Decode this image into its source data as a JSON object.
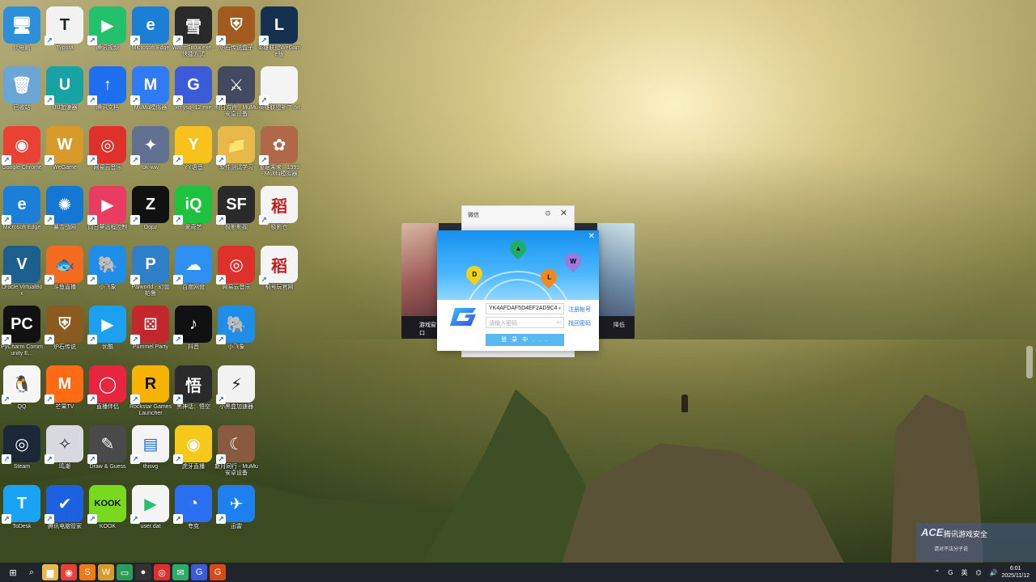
{
  "desktop": {
    "icons": [
      {
        "label": "此电脑",
        "glyph": "🖥",
        "bg": "#2d8fd8"
      },
      {
        "label": "Typora",
        "glyph": "T",
        "bg": "#f2f2f2",
        "fg": "#222"
      },
      {
        "label": "腾讯视频",
        "glyph": "▶",
        "bg": "#23c16b"
      },
      {
        "label": "Microsoft Edge",
        "glyph": "e",
        "bg": "#1b7fd8"
      },
      {
        "label": "WarmSnow.exe - 快捷方式",
        "glyph": "雪",
        "bg": "#2a2a2a"
      },
      {
        "label": "炉石传说盒子",
        "glyph": "⛨",
        "bg": "#a35a1e"
      },
      {
        "label": "英雄联盟WeGame版",
        "glyph": "L",
        "bg": "#14324f"
      },
      {
        "label": "回收站",
        "glyph": "🗑",
        "bg": "#6aa6d6"
      },
      {
        "label": "UU加速器",
        "glyph": "U",
        "bg": "#17a3a3"
      },
      {
        "label": "腾讯文档",
        "glyph": "↑",
        "bg": "#1e6ff0"
      },
      {
        "label": "MuMu模拟器",
        "glyph": "M",
        "bg": "#2f7bf5"
      },
      {
        "label": "xmysq_12.exe",
        "glyph": "G",
        "bg": "#3b5bd8"
      },
      {
        "label": "明日方舟 - MuMu安卓设备",
        "glyph": "⚔",
        "bg": "#434a60"
      },
      {
        "label": "英雄联盟补丁.txt",
        "glyph": "",
        "bg": "#f4f4f4"
      },
      {
        "label": "Google Chrome",
        "glyph": "◉",
        "bg": "#e94235"
      },
      {
        "label": "WeGame",
        "glyph": "W",
        "bg": "#d79a2a"
      },
      {
        "label": "网易云音乐",
        "glyph": "◎",
        "bg": "#e0302b"
      },
      {
        "label": "ok-ww",
        "glyph": "✦",
        "bg": "#607090"
      },
      {
        "label": "YY语音",
        "glyph": "Y",
        "bg": "#f6c21b"
      },
      {
        "label": "软件测试学习",
        "glyph": "📁",
        "bg": "#e8b94a"
      },
      {
        "label": "重返未来：1999 - MuMu模拟器",
        "glyph": "✿",
        "bg": "#b06848"
      },
      {
        "label": "Microsoft Edge",
        "glyph": "e",
        "bg": "#1b7fd8"
      },
      {
        "label": "暴雪战网",
        "glyph": "✺",
        "bg": "#1477d6"
      },
      {
        "label": "向日葵远程控制",
        "glyph": "▶",
        "bg": "#ea3b63"
      },
      {
        "label": "Oopz",
        "glyph": "Z",
        "bg": "#111111"
      },
      {
        "label": "爱奇艺",
        "glyph": "iQ",
        "bg": "#1fc23e"
      },
      {
        "label": "极影影视",
        "glyph": "SF",
        "bg": "#2a2a2a"
      },
      {
        "label": "极影仓",
        "glyph": "稻",
        "bg": "#f4f4f4",
        "fg": "#c02020"
      },
      {
        "label": "Oracle VirtualBox",
        "glyph": "V",
        "bg": "#1c5f8f"
      },
      {
        "label": "斗鱼直播",
        "glyph": "🐟",
        "bg": "#f36b1f"
      },
      {
        "label": "小飞象",
        "glyph": "🐘",
        "bg": "#1f8ee8"
      },
      {
        "label": "Palworld - 幻兽帕鲁",
        "glyph": "P",
        "bg": "#2f7ec8"
      },
      {
        "label": "百度网盘",
        "glyph": "☁",
        "bg": "#2f8ff0"
      },
      {
        "label": "网易云音乐",
        "glyph": "◎",
        "bg": "#e0302b"
      },
      {
        "label": "稻号玩官网",
        "glyph": "稻",
        "bg": "#f4f4f4",
        "fg": "#c02020"
      },
      {
        "label": "PyCharm Community E...",
        "glyph": "PC",
        "bg": "#111111"
      },
      {
        "label": "炉石传说",
        "glyph": "⛨",
        "bg": "#8b5a1f"
      },
      {
        "label": "优酷",
        "glyph": "▶",
        "bg": "#1ea0f2"
      },
      {
        "label": "Pummel Party",
        "glyph": "⚄",
        "bg": "#c1272d"
      },
      {
        "label": "抖音",
        "glyph": "♪",
        "bg": "#111111"
      },
      {
        "label": "小飞象",
        "glyph": "🐘",
        "bg": "#1f8ee8"
      },
      {
        "label": "",
        "glyph": "",
        "bg": "transparent"
      },
      {
        "label": "QQ",
        "glyph": "🐧",
        "bg": "#f6f6f6"
      },
      {
        "label": "芒果TV",
        "glyph": "M",
        "bg": "#ff6a13"
      },
      {
        "label": "直播伴侣",
        "glyph": "◯",
        "bg": "#e8253f"
      },
      {
        "label": "Rockstar Games Launcher",
        "glyph": "R",
        "bg": "#f6b300",
        "fg": "#111"
      },
      {
        "label": "黑神话：悟空",
        "glyph": "悟",
        "bg": "#2a2a2a"
      },
      {
        "label": "小黑盒加速器",
        "glyph": "⚡",
        "bg": "#f2f2f2",
        "fg": "#222"
      },
      {
        "label": "",
        "glyph": "",
        "bg": "transparent"
      },
      {
        "label": "Steam",
        "glyph": "◎",
        "bg": "#1b2838"
      },
      {
        "label": "鸣潮",
        "glyph": "✧",
        "bg": "#d8d8e0",
        "fg": "#223"
      },
      {
        "label": "Draw & Guess",
        "glyph": "✎",
        "bg": "#4a4a4a"
      },
      {
        "label": "thisvg",
        "glyph": "▤",
        "bg": "#f4f4f4",
        "fg": "#1e6bd6"
      },
      {
        "label": "虎牙直播",
        "glyph": "◉",
        "bg": "#f7c81c"
      },
      {
        "label": "新月同行 - MuMu安卓设备",
        "glyph": "☾",
        "bg": "#8a5a40"
      },
      {
        "label": "",
        "glyph": "",
        "bg": "transparent"
      },
      {
        "label": "ToDesk",
        "glyph": "T",
        "bg": "#1aa3f4"
      },
      {
        "label": "腾讯电脑管家",
        "glyph": "✔",
        "bg": "#1c62e0"
      },
      {
        "label": "KOOK",
        "glyph": "KOOK",
        "bg": "#79d91e",
        "fg": "#111"
      },
      {
        "label": "user.dat",
        "glyph": "▶",
        "bg": "#f4f4f4",
        "fg": "#23c16b"
      },
      {
        "label": "夸克",
        "glyph": "◔",
        "bg": "#2a6ef2"
      },
      {
        "label": "迅雷",
        "glyph": "✈",
        "bg": "#1e7ff0"
      },
      {
        "label": "",
        "glyph": "",
        "bg": "transparent"
      }
    ]
  },
  "background_window": {
    "left_caption": "游戏窗口",
    "right_caption": "降低"
  },
  "wechat_window": {
    "title": "微信",
    "settings_glyph": "⚙",
    "close_glyph": "✕"
  },
  "login_dialog": {
    "close_glyph": "✕",
    "account_value": "YK4AFDAF5D4EF2AD9C4",
    "password_placeholder": "请输入密码",
    "register_link": "注册帐号",
    "forgot_link": "找回密码",
    "login_button": "登 录 中 . . .",
    "pins": [
      {
        "glyph": "D",
        "color": "#f0d21a"
      },
      {
        "glyph": "▲",
        "color": "#1fae6a"
      },
      {
        "glyph": "L",
        "color": "#f08a1c"
      },
      {
        "glyph": "W",
        "color": "#9a7bdc"
      }
    ]
  },
  "ace_widget": {
    "logo": "ACE",
    "title": "腾讯游戏安全",
    "subtitle": "请对不法分子说"
  },
  "taskbar": {
    "icons": [
      {
        "name": "start",
        "glyph": "⊞",
        "bg": "transparent"
      },
      {
        "name": "search",
        "glyph": "⌕",
        "bg": "transparent"
      },
      {
        "name": "file-explorer",
        "glyph": "▆",
        "bg": "#e8b94a"
      },
      {
        "name": "chrome",
        "glyph": "◉",
        "bg": "#e94235"
      },
      {
        "name": "sublime",
        "glyph": "S",
        "bg": "#f07a1a"
      },
      {
        "name": "wegame",
        "glyph": "W",
        "bg": "#d79a2a"
      },
      {
        "name": "terminal",
        "glyph": "▭",
        "bg": "#2a9d5a"
      },
      {
        "name": "obs",
        "glyph": "●",
        "bg": "#333"
      },
      {
        "name": "netease-music",
        "glyph": "◎",
        "bg": "#e0302b"
      },
      {
        "name": "wechat",
        "glyph": "✉",
        "bg": "#2aae67"
      },
      {
        "name": "xmysq",
        "glyph": "G",
        "bg": "#3b5bd8"
      },
      {
        "name": "game-g",
        "glyph": "G",
        "bg": "#d94a1a"
      }
    ],
    "tray": {
      "chevron": "⌃",
      "app_tray": "G",
      "ime": "英",
      "network": "⌬",
      "volume": "🔊",
      "time": "6:01",
      "date": "2025/11/12"
    }
  }
}
